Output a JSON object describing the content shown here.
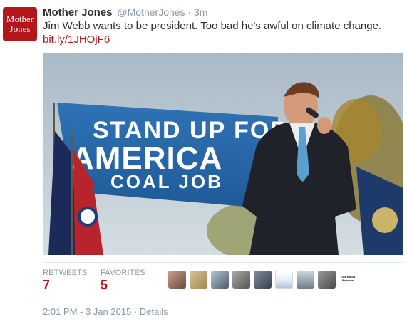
{
  "account": {
    "avatar_line1": "Mother",
    "avatar_line2": "Jones",
    "name": "Mother Jones",
    "handle": "@MotherJones",
    "separator": "·",
    "time_ago": "3m"
  },
  "tweet": {
    "text": "Jim Webb wants to be president. Too bad he's awful on climate change.",
    "link": "bit.ly/1JHOjF6"
  },
  "photo": {
    "banner_line1": "STAND UP FOR",
    "banner_line2": "AMERICA",
    "banner_line3": "COAL JOB"
  },
  "stats": {
    "retweets_label": "RETWEETS",
    "retweets_count": "7",
    "favorites_label": "FAVORITES",
    "favorites_count": "5",
    "last_face_text": "The Blood Reporter"
  },
  "footer": {
    "timestamp": "2:01 PM - 3 Jan 2015",
    "separator": "·",
    "details_label": "Details"
  },
  "colors": {
    "brand": "#b5161b",
    "muted": "#8899a6",
    "text": "#292f33"
  }
}
